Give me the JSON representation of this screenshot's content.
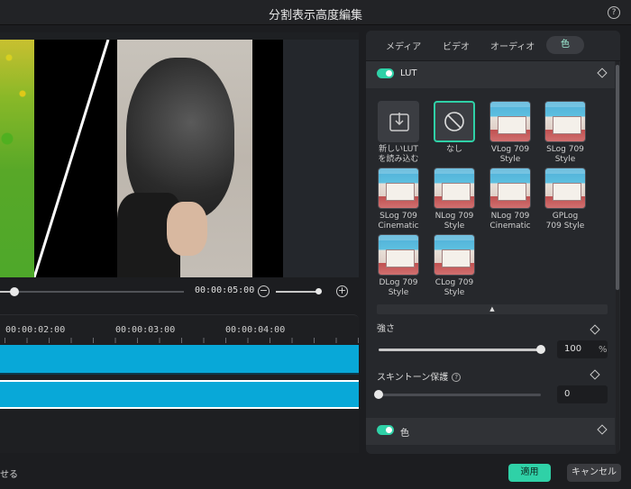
{
  "window": {
    "title": "分割表示高度編集",
    "help": "?"
  },
  "playback": {
    "timecode": "00:00:05:00",
    "zoom_out": "−",
    "zoom_in": "+",
    "progress": 0.08
  },
  "timeline": {
    "ruler": [
      "00:00:02:00",
      "00:00:03:00",
      "00:00:04:00"
    ]
  },
  "panel": {
    "tabs": [
      "メディア",
      "ビデオ",
      "オーディオ",
      "色"
    ],
    "active_tab": "色",
    "lut_section": {
      "title": "LUT"
    },
    "lut_items": [
      {
        "label": "新しいLUT\nを読み込む",
        "kind": "import"
      },
      {
        "label": "なし",
        "kind": "none"
      },
      {
        "label": "VLog 709\nStyle",
        "kind": "photo"
      },
      {
        "label": "SLog 709\nStyle",
        "kind": "photo"
      },
      {
        "label": "SLog 709\nCinematic",
        "kind": "photo"
      },
      {
        "label": "NLog 709\nStyle",
        "kind": "photo"
      },
      {
        "label": "NLog 709\nCinematic",
        "kind": "photo"
      },
      {
        "label": "GPLog\n709 Style",
        "kind": "photo"
      },
      {
        "label": "DLog 709\nStyle",
        "kind": "photo"
      },
      {
        "label": "CLog 709\nStyle",
        "kind": "photo"
      }
    ],
    "collapse": "▲",
    "strength": {
      "label": "強さ",
      "value": "100",
      "unit": "%",
      "level": 1.0
    },
    "skin_tone": {
      "label": "スキントーン保護",
      "help": "?",
      "value": "0",
      "level": 0.0
    },
    "color_section": {
      "title": "色"
    }
  },
  "footer": {
    "left_text": "せる",
    "apply": "適用",
    "cancel": "キャンセル"
  },
  "colors": {
    "accent": "#2fd1a7",
    "track": "#08a8d8"
  }
}
